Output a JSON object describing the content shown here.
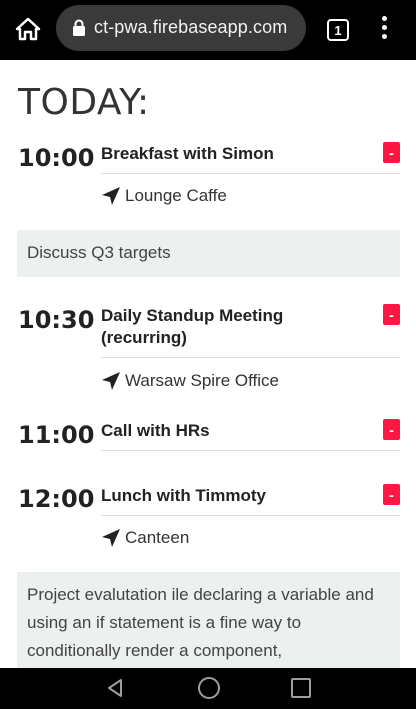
{
  "browser": {
    "url": "ct-pwa.firebaseapp.com",
    "tab_count": "1"
  },
  "page": {
    "heading": "TODAY:"
  },
  "events": [
    {
      "time": "10:00",
      "title": "Breakfast with Simon",
      "location": "Lounge Caffe",
      "delete_label": "-"
    },
    {
      "time": "10:30",
      "title": "Daily Standup Meeting (recurring)",
      "location": "Warsaw Spire Office",
      "delete_label": "-"
    },
    {
      "time": "11:00",
      "title": "Call with HRs",
      "delete_label": "-"
    },
    {
      "time": "12:00",
      "title": "Lunch with Timmoty",
      "location": "Canteen",
      "delete_label": "-"
    }
  ],
  "notes": {
    "note_1": "Discuss Q3 targets",
    "note_2": "Project evalutation ile declaring a variable and using an if statement is a fine way to conditionally render a component,"
  },
  "colors": {
    "delete_button": "#ff1744",
    "note_background": "#ecf0ef"
  },
  "icons": {
    "home": "home-icon",
    "lock": "lock-icon",
    "tabs": "tabs-icon",
    "menu": "more-vert-icon",
    "location": "navigation-arrow-icon",
    "back": "back-triangle-icon",
    "nav_home": "circle-home-icon",
    "recent": "square-recents-icon"
  }
}
